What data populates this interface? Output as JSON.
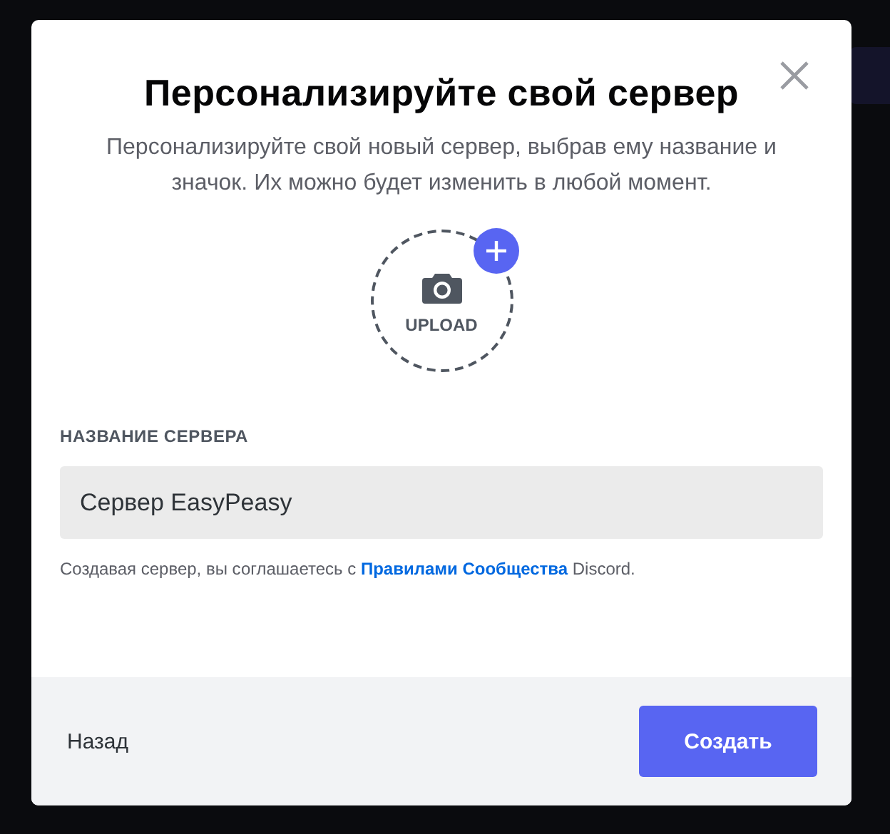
{
  "dialog": {
    "title": "Персонализируйте свой сервер",
    "description": "Персонализируйте свой новый сервер, выбрав ему название и значок. Их можно будет изменить в любой момент."
  },
  "upload": {
    "label": "UPLOAD"
  },
  "server_name": {
    "label": "НАЗВАНИЕ СЕРВЕРА",
    "value": "Сервер EasyPeasy"
  },
  "terms": {
    "before": "Создавая сервер, вы соглашаетесь с ",
    "link": "Правилами Сообщества",
    "after": " Discord."
  },
  "footer": {
    "back": "Назад",
    "create": "Создать"
  }
}
